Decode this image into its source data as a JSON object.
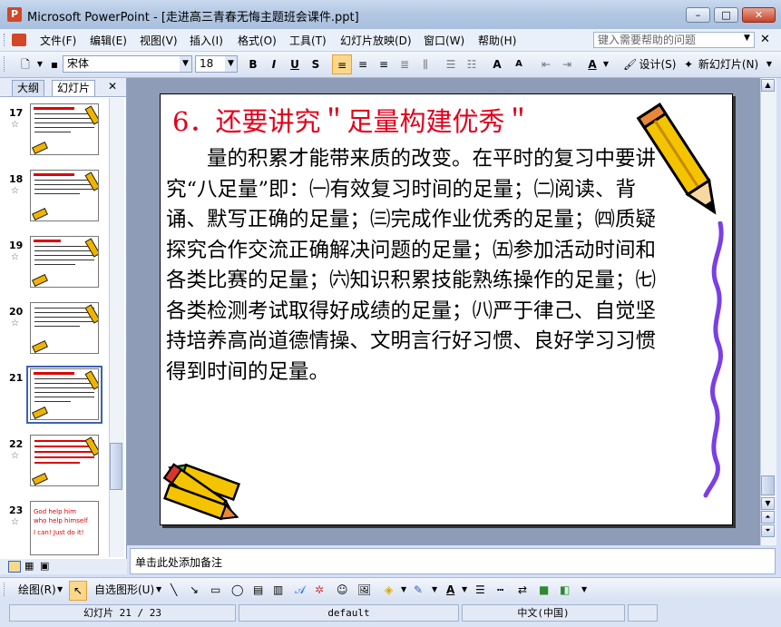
{
  "window": {
    "app_icon": "P",
    "title": "Microsoft PowerPoint - [走进高三青春无悔主题班会课件.ppt]",
    "minimize": "–",
    "maximize": "□",
    "close": "✕"
  },
  "menu": {
    "items": [
      "文件(F)",
      "编辑(E)",
      "视图(V)",
      "插入(I)",
      "格式(O)",
      "工具(T)",
      "幻灯片放映(D)",
      "窗口(W)",
      "帮助(H)"
    ],
    "help_placeholder": "键入需要帮助的问题"
  },
  "toolbar": {
    "font": "宋体",
    "size": "18",
    "bold": "B",
    "italic": "I",
    "underline": "U",
    "shadow": "S",
    "increase_font": "A",
    "decrease_font": "A",
    "font_color": "A",
    "design": "设计(S)",
    "new_slide": "新幻灯片(N)"
  },
  "left_pane": {
    "tabs": [
      "大纲",
      "幻灯片"
    ],
    "close": "✕",
    "slide_numbers": [
      "17",
      "18",
      "19",
      "20",
      "21",
      "22",
      "23"
    ],
    "star": "☆",
    "thumb23_lines": [
      "God help him",
      "who help himself",
      "I can! Just do it!"
    ]
  },
  "slide": {
    "title": "6．还要讲究＂足量构建优秀＂",
    "body": "　　量的积累才能带来质的改变。在平时的复习中要讲究“八足量”即：㈠有效复习时间的足量；㈡阅读、背诵、默写正确的足量；㈢完成作业优秀的足量；㈣质疑探究合作交流正确解决问题的足量；㈤参加活动时间和各类比赛的足量；㈥知识积累技能熟练操作的足量；㈦各类检测考试取得好成绩的足量；㈧严于律己、自觉坚持培养高尚道德情操、文明言行好习惯、良好学习习惯得到时间的足量。"
  },
  "notes": {
    "placeholder": "单击此处添加备注"
  },
  "draw_toolbar": {
    "draw": "绘图(R)",
    "autoshapes": "自选图形(U)"
  },
  "status_bar": {
    "slide_position": "幻灯片 21 / 23",
    "design": "default",
    "language": "中文(中国)"
  },
  "colors": {
    "title_red": "#e3001b",
    "selection_blue": "#3b63b0",
    "pencil_yellow": "#f0b400",
    "squiggle_purple": "#7b3fe4"
  }
}
